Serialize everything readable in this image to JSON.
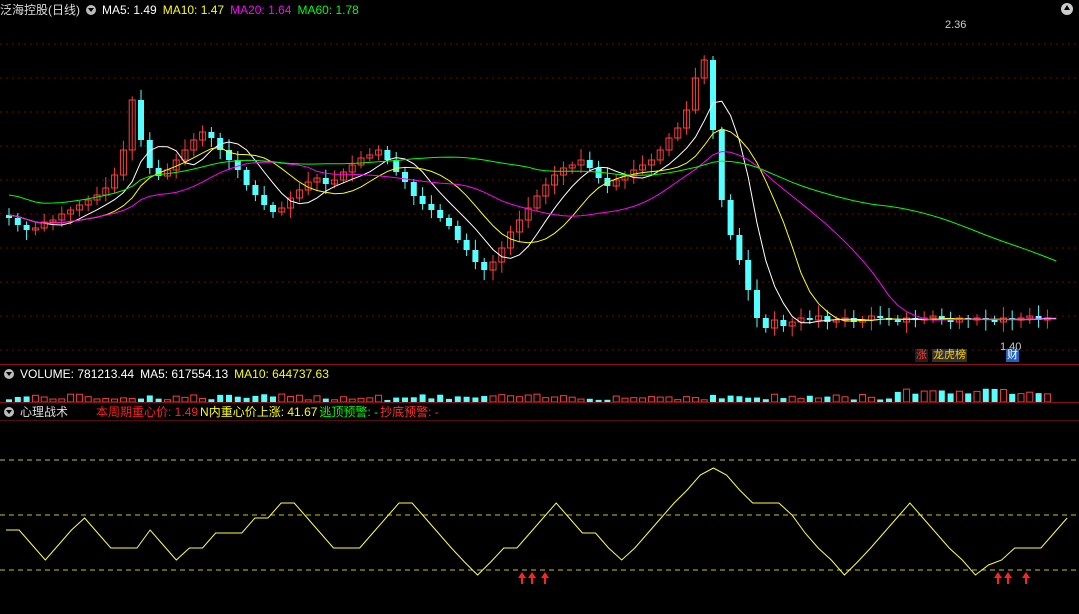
{
  "main": {
    "title": "泛海控股(日线)",
    "ma_labels": [
      {
        "text": "MA5: 1.49",
        "color": "#ffffff"
      },
      {
        "text": "MA10: 1.47",
        "color": "#ffff00"
      },
      {
        "text": "MA20: 1.64",
        "color": "#ff00ff"
      },
      {
        "text": "MA60: 1.78",
        "color": "#00ff00"
      }
    ],
    "high_label": "2.36",
    "low_label": "1.40",
    "tags": [
      {
        "text": "涨",
        "color": "#ff3030",
        "bg": "#202020"
      },
      {
        "text": "龙虎榜",
        "color": "#ffd000",
        "bg": "#303030"
      },
      {
        "text": "财",
        "color": "#ffffff",
        "bg": "#2060c0"
      }
    ]
  },
  "volume": {
    "labels": [
      {
        "text": "VOLUME: 781213.44",
        "color": "#ffffff"
      },
      {
        "text": "MA5: 617554.13",
        "color": "#ffffff"
      },
      {
        "text": "MA10: 644737.63",
        "color": "#ffff00"
      }
    ]
  },
  "indicator": {
    "name": "心理战术",
    "labels": [
      {
        "text": "本周期重心价: 1.49",
        "color": "#ff2020"
      },
      {
        "text": "N内重心价上涨: 41.67",
        "color": "#ffff00"
      },
      {
        "text": "逃顶预警: -",
        "color": "#00ff00"
      },
      {
        "text": "抄底预警: -",
        "color": "#ff3030"
      }
    ]
  },
  "colors": {
    "up": "#ff3c3c",
    "down": "#54ffff",
    "ma5": "#ffffff",
    "ma10": "#ffff00",
    "ma20": "#ff00ff",
    "ma60": "#00ff00",
    "grid": "#7a0000"
  }
}
